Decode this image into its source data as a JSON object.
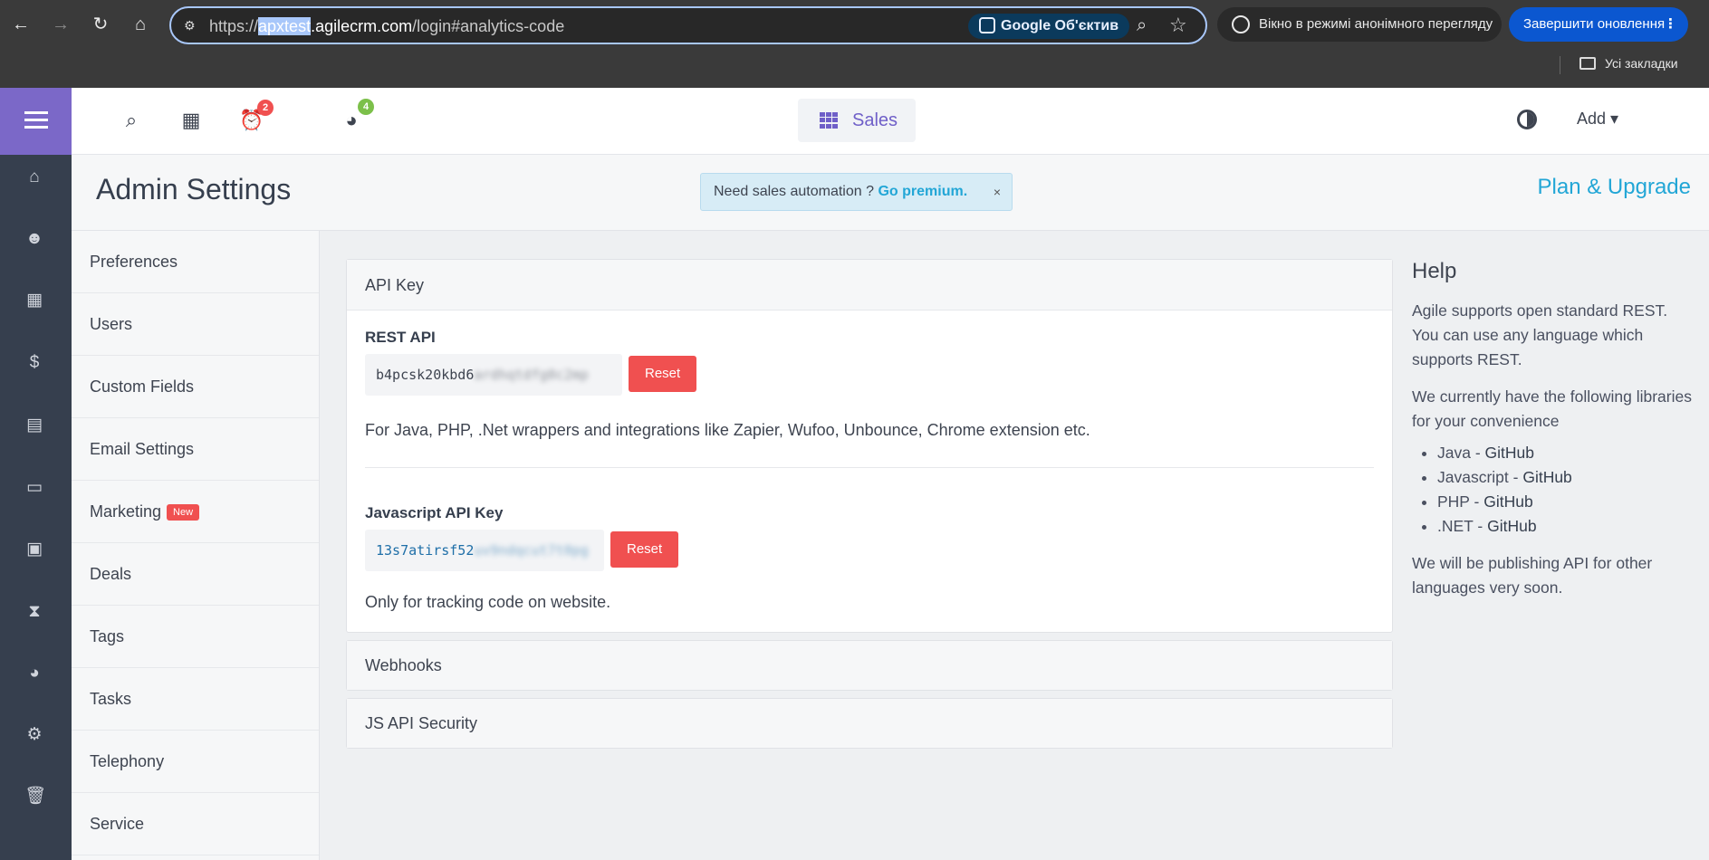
{
  "browser": {
    "url_prefix": "https://",
    "url_highlight": "apxtest",
    "url_domain": ".agilecrm.com",
    "url_path": "/login#analytics-code",
    "lens_label": "Google Об'єктив",
    "incognito_label": "Вікно в режимі анонімного перегляду",
    "update_label": "Завершити оновлення",
    "bookmarks_label": "Усі закладки"
  },
  "topbar": {
    "notifications_badge": "2",
    "reports_badge": "4",
    "sales_label": "Sales",
    "add_label": "Add ▾"
  },
  "header": {
    "title": "Admin Settings",
    "promo_text": "Need sales automation ? ",
    "promo_link": "Go premium.",
    "promo_close": "×",
    "plan_link": "Plan & Upgrade"
  },
  "settings_nav": [
    {
      "label": "Preferences"
    },
    {
      "label": "Users"
    },
    {
      "label": "Custom Fields"
    },
    {
      "label": "Email Settings"
    },
    {
      "label": "Marketing",
      "tag": "New"
    },
    {
      "label": "Deals"
    },
    {
      "label": "Tags"
    },
    {
      "label": "Tasks"
    },
    {
      "label": "Telephony"
    },
    {
      "label": "Service"
    }
  ],
  "api_panel": {
    "title": "API Key",
    "rest_label": "REST API",
    "rest_key_visible": "b4pcsk20kbd6",
    "rest_key_blurred": "ardhqtdfg0c2mp",
    "rest_reset": "Reset",
    "rest_desc": "For Java, PHP, .Net wrappers and integrations like Zapier, Wufoo, Unbounce, Chrome extension etc.",
    "js_label": "Javascript API Key",
    "js_key_visible": "13s7atirsf52",
    "js_key_blurred": "uv9ndqcut7t0pg",
    "js_reset": "Reset",
    "js_desc": "Only for tracking code on website."
  },
  "collapsed_panels": {
    "webhooks": "Webhooks",
    "js_security": "JS API Security"
  },
  "help": {
    "title": "Help",
    "p1": "Agile supports open standard REST. You can use any language which supports REST.",
    "p2": "We currently have the following libraries for your convenience",
    "libs": [
      {
        "name": "Java - ",
        "link": "GitHub"
      },
      {
        "name": "Javascript - ",
        "link": "GitHub"
      },
      {
        "name": "PHP - ",
        "link": "GitHub"
      },
      {
        "name": ".NET - ",
        "link": "GitHub"
      }
    ],
    "p3": "We will be publishing API for other languages very soon."
  },
  "colors": {
    "accent_purple": "#7b68c8",
    "nav_dark": "#363f4e",
    "link_blue": "#22a6d6",
    "danger_red": "#f05050"
  }
}
